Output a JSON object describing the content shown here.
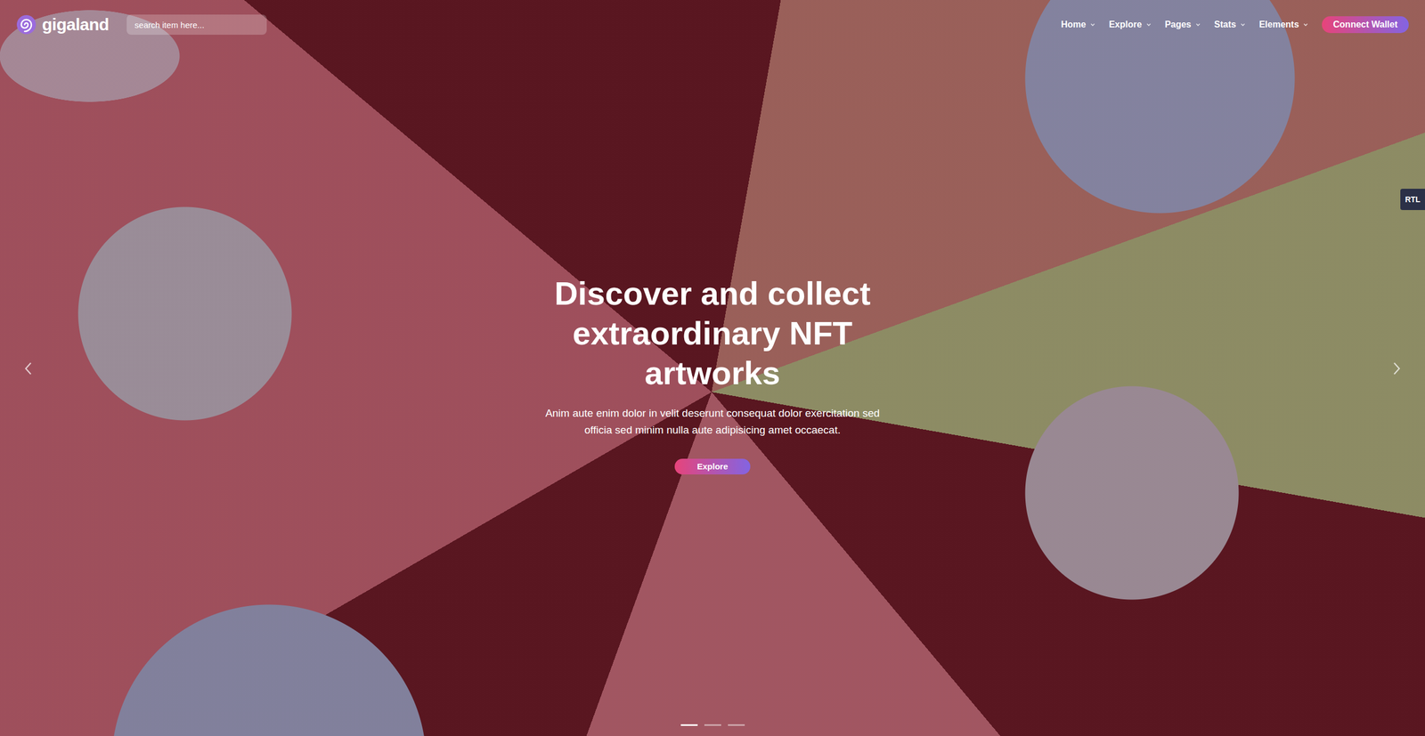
{
  "header": {
    "logo": "gigaland",
    "search": {
      "placeholder": "search item here..."
    },
    "nav": [
      {
        "label": "Home",
        "dropdown": true
      },
      {
        "label": "Explore",
        "dropdown": true
      },
      {
        "label": "Pages",
        "dropdown": true
      },
      {
        "label": "Stats",
        "dropdown": true
      },
      {
        "label": "Elements",
        "dropdown": true
      }
    ],
    "connect_button": "Connect Wallet"
  },
  "rtl_toggle": "RTL",
  "hero": {
    "title_lines": [
      "Discover and collect",
      "extraordinary NFT",
      "artworks"
    ],
    "text": "Anim aute enim dolor in velit deserunt consequat dolor exercitation sed officia sed minim nulla aute adipisicing amet occaecat.",
    "button": "Explore"
  },
  "slider": {
    "dots": [
      {
        "selected": true
      },
      {
        "selected": false
      },
      {
        "selected": false
      }
    ]
  }
}
